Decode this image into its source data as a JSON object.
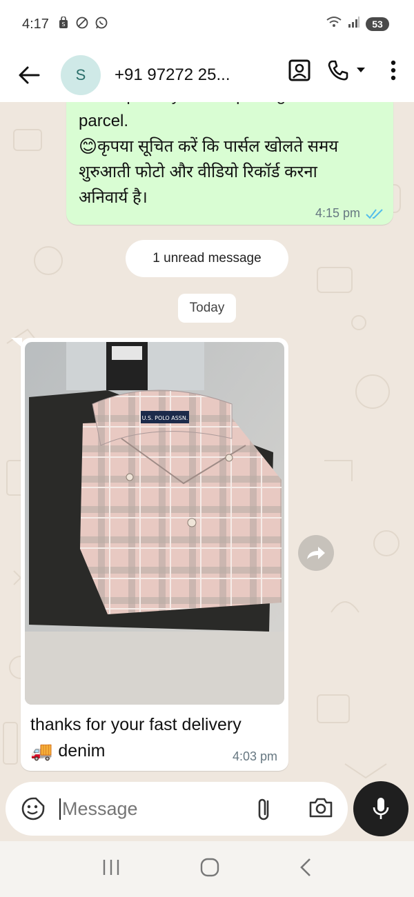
{
  "status_bar": {
    "time": "4:17",
    "battery": "53"
  },
  "header": {
    "avatar_letter": "S",
    "contact_name": "+91 97272 25..."
  },
  "messages": {
    "outgoing": {
      "cut_line": "is compulsory while opening the",
      "lines": [
        "parcel.",
        "कृपया सूचित करें कि पार्सल खोलते समय",
        "शुरुआती फोटो और वीडियो रिकॉर्ड करना",
        "अनिवार्य है।"
      ],
      "emoji": "😊",
      "time": "4:15 pm"
    },
    "unread_label": "1 unread message",
    "date_label": "Today",
    "incoming": {
      "caption_line1": "thanks for your fast delivery",
      "caption_line2": "denim",
      "caption_emoji": "🚚",
      "time": "4:03 pm",
      "photo_label": "U.S. POLO ASSN."
    }
  },
  "composer": {
    "placeholder": "Message"
  },
  "colors": {
    "outgoing_bubble": "#d9fdd3",
    "incoming_bubble": "#ffffff",
    "read_ticks": "#53bdeb",
    "chat_background": "#efe7de"
  }
}
